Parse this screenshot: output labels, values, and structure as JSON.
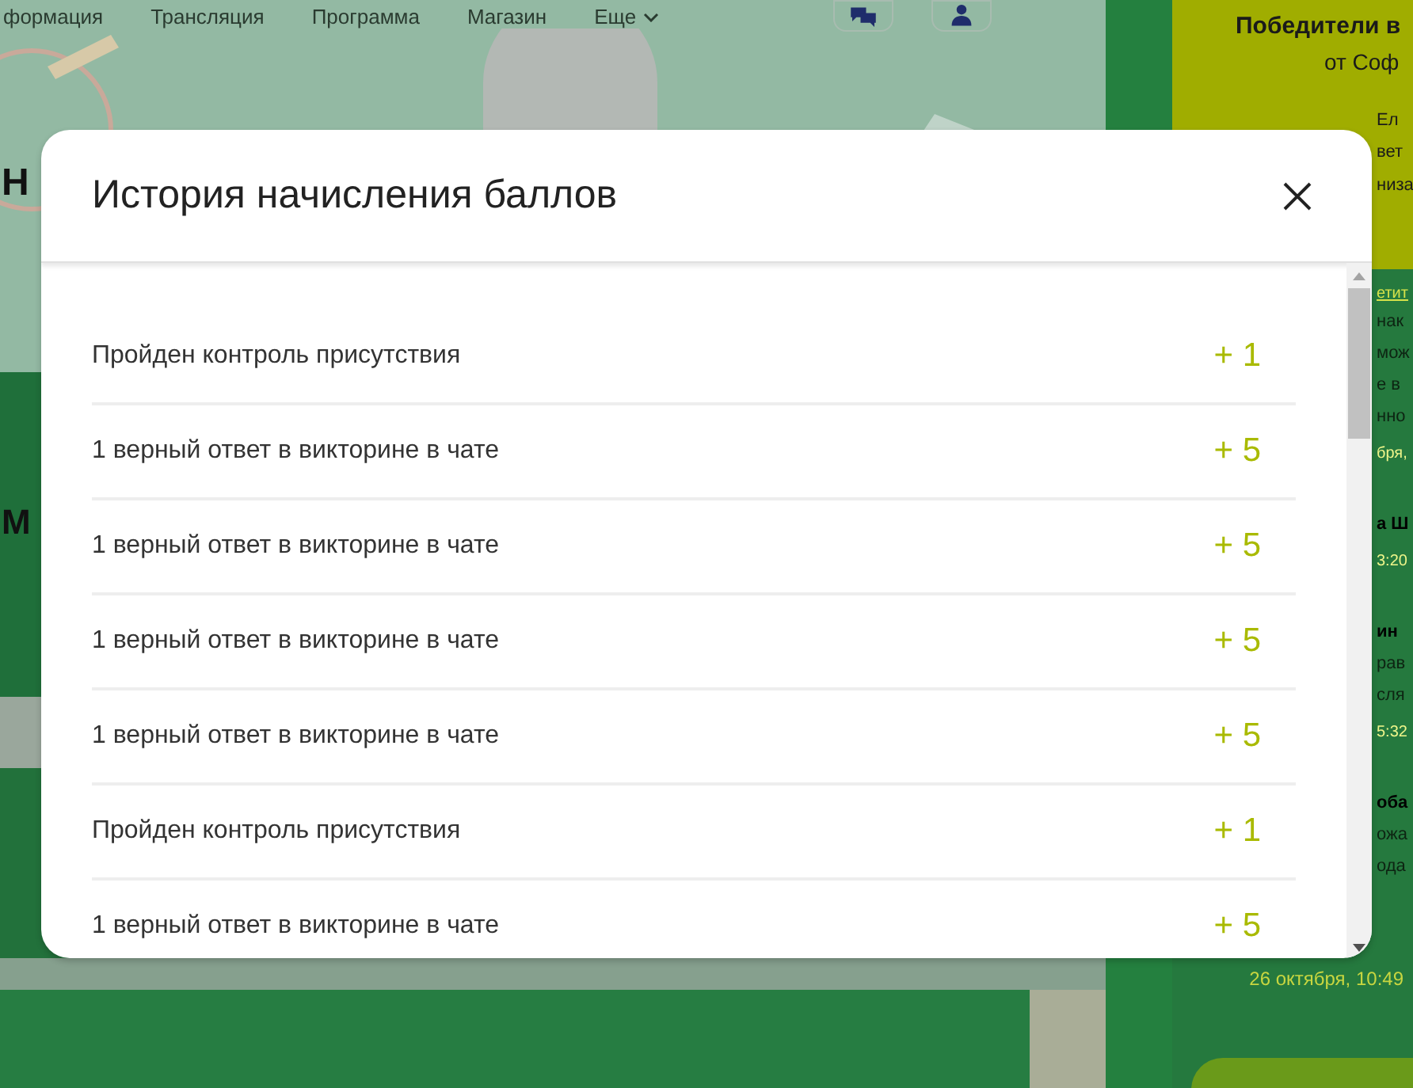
{
  "nav": {
    "items": [
      {
        "label": "формация",
        "has_caret": false
      },
      {
        "label": "Трансляция",
        "has_caret": false
      },
      {
        "label": "Программа",
        "has_caret": false
      },
      {
        "label": "Магазин",
        "has_caret": false
      },
      {
        "label": "Еще",
        "has_caret": true
      }
    ]
  },
  "banner": {
    "heading": "Н",
    "subheading": "М"
  },
  "winners_card": {
    "title": "Победители в",
    "subtitle": "от Соф",
    "lines": [
      "Ел",
      "вет",
      "низа"
    ]
  },
  "chat": {
    "link": "етит",
    "messages": [
      {
        "kind": "text",
        "text": "нак"
      },
      {
        "kind": "text",
        "text": "мож"
      },
      {
        "kind": "text",
        "text": "е в"
      },
      {
        "kind": "text",
        "text": "нно"
      },
      {
        "kind": "time",
        "text": "бря,"
      },
      {
        "kind": "name",
        "text": "а Ш"
      },
      {
        "kind": "time",
        "text": "3:20"
      },
      {
        "kind": "name",
        "text": "ин"
      },
      {
        "kind": "text",
        "text": "рав"
      },
      {
        "kind": "text",
        "text": "сля"
      },
      {
        "kind": "time",
        "text": "5:32"
      },
      {
        "kind": "name",
        "text": "оба"
      },
      {
        "kind": "text",
        "text": "ожа"
      },
      {
        "kind": "text",
        "text": "ода"
      }
    ],
    "last_time": "26 октября, 10:49"
  },
  "modal": {
    "title": "История начисления баллов",
    "entries": [
      {
        "label": "Пройден контроль присутствия",
        "points": "+ 1"
      },
      {
        "label": "1 верный ответ в викторине в чате",
        "points": "+ 5"
      },
      {
        "label": "1 верный ответ в викторине в чате",
        "points": "+ 5"
      },
      {
        "label": "1 верный ответ в викторине в чате",
        "points": "+ 5"
      },
      {
        "label": "1 верный ответ в викторине в чате",
        "points": "+ 5"
      },
      {
        "label": "Пройден контроль присутствия",
        "points": "+ 1"
      },
      {
        "label": "1 верный ответ в викторине в чате",
        "points": "+ 5"
      }
    ]
  }
}
